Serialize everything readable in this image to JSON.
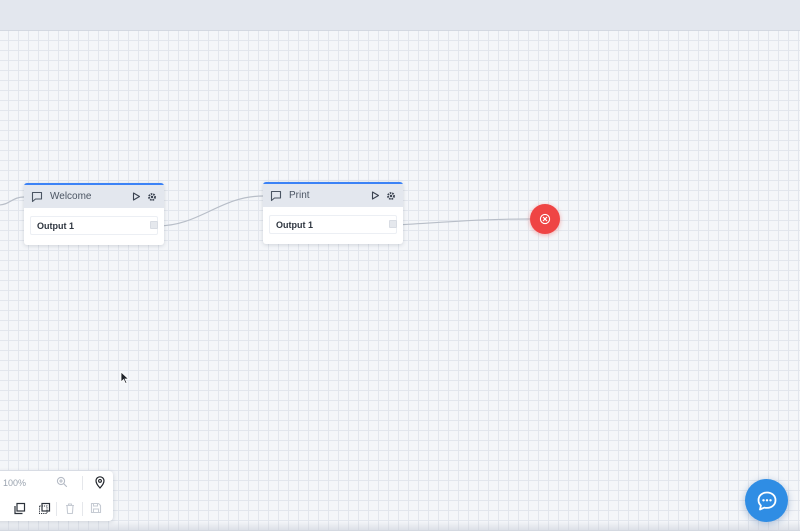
{
  "flow": {
    "nodes": [
      {
        "title": "Welcome",
        "output_label": "Output 1",
        "icon": "message-icon"
      },
      {
        "title": "Print",
        "output_label": "Output 1",
        "icon": "message-icon"
      }
    ],
    "end_node": {
      "icon": "close-circle-icon",
      "color": "#ef4444"
    }
  },
  "toolbar": {
    "zoom_label": "100%",
    "icons": [
      "zoom-in-icon",
      "locate-icon",
      "copy-icon",
      "select-icon",
      "delete-icon",
      "save-icon"
    ]
  },
  "chat": {
    "icon": "chat-bubble-icon",
    "color": "#2f8de4"
  },
  "colors": {
    "accent": "#3b82f6",
    "canvas": "#f4f6f9"
  }
}
